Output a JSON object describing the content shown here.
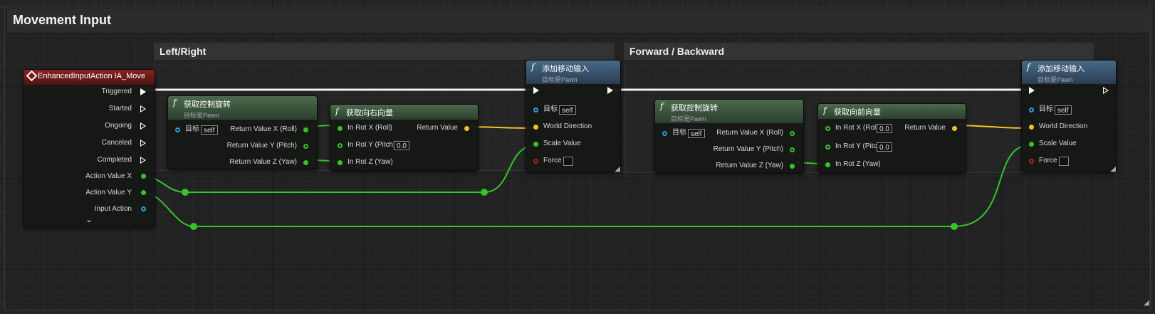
{
  "comment_main": {
    "title": "Movement Input"
  },
  "comment_left": {
    "title": "Left/Right"
  },
  "comment_right": {
    "title": "Forward / Backward"
  },
  "event_node": {
    "title": "EnhancedInputAction IA_Move",
    "pins": [
      "Triggered",
      "Started",
      "Ongoing",
      "Canceled",
      "Completed",
      "Action Value X",
      "Action Value Y",
      "Input Action"
    ],
    "expand_icon": "chevron-down-icon"
  },
  "get_control_rotation_1": {
    "title": "获取控制旋转",
    "subtitle": "目标是Pawn",
    "target_label": "目标",
    "target_value": "self",
    "outputs": [
      "Return Value X (Roll)",
      "Return Value Y (Pitch)",
      "Return Value Z (Yaw)"
    ]
  },
  "get_right_vector": {
    "title": "获取向右向量",
    "inputs": [
      "In Rot X (Roll)",
      "In Rot Y (Pitch)",
      "In Rot Z (Yaw)"
    ],
    "pitch_value": "0.0",
    "output": "Return Value"
  },
  "add_movement_1": {
    "title": "添加移动输入",
    "subtitle": "目标是Pawn",
    "target_label": "目标",
    "target_value": "self",
    "inputs": [
      "World Direction",
      "Scale Value",
      "Force"
    ]
  },
  "get_control_rotation_2": {
    "title": "获取控制旋转",
    "subtitle": "目标是Pawn",
    "target_label": "目标",
    "target_value": "self",
    "outputs": [
      "Return Value X (Roll)",
      "Return Value Y (Pitch)",
      "Return Value Z (Yaw)"
    ]
  },
  "get_forward_vector": {
    "title": "获取向前向量",
    "inputs": [
      "In Rot X (Roll)",
      "In Rot Y (Pitch)",
      "In Rot Z (Yaw)"
    ],
    "roll_value": "0.0",
    "pitch_value": "0.0",
    "output": "Return Value"
  },
  "add_movement_2": {
    "title": "添加移动输入",
    "subtitle": "目标是Pawn",
    "target_label": "目标",
    "target_value": "self",
    "inputs": [
      "World Direction",
      "Scale Value",
      "Force"
    ]
  },
  "colors": {
    "exec": "#ffffff",
    "float": "#35c42b",
    "vector": "#f4c22b",
    "object": "#2e9ddb",
    "bool": "#b32020"
  }
}
